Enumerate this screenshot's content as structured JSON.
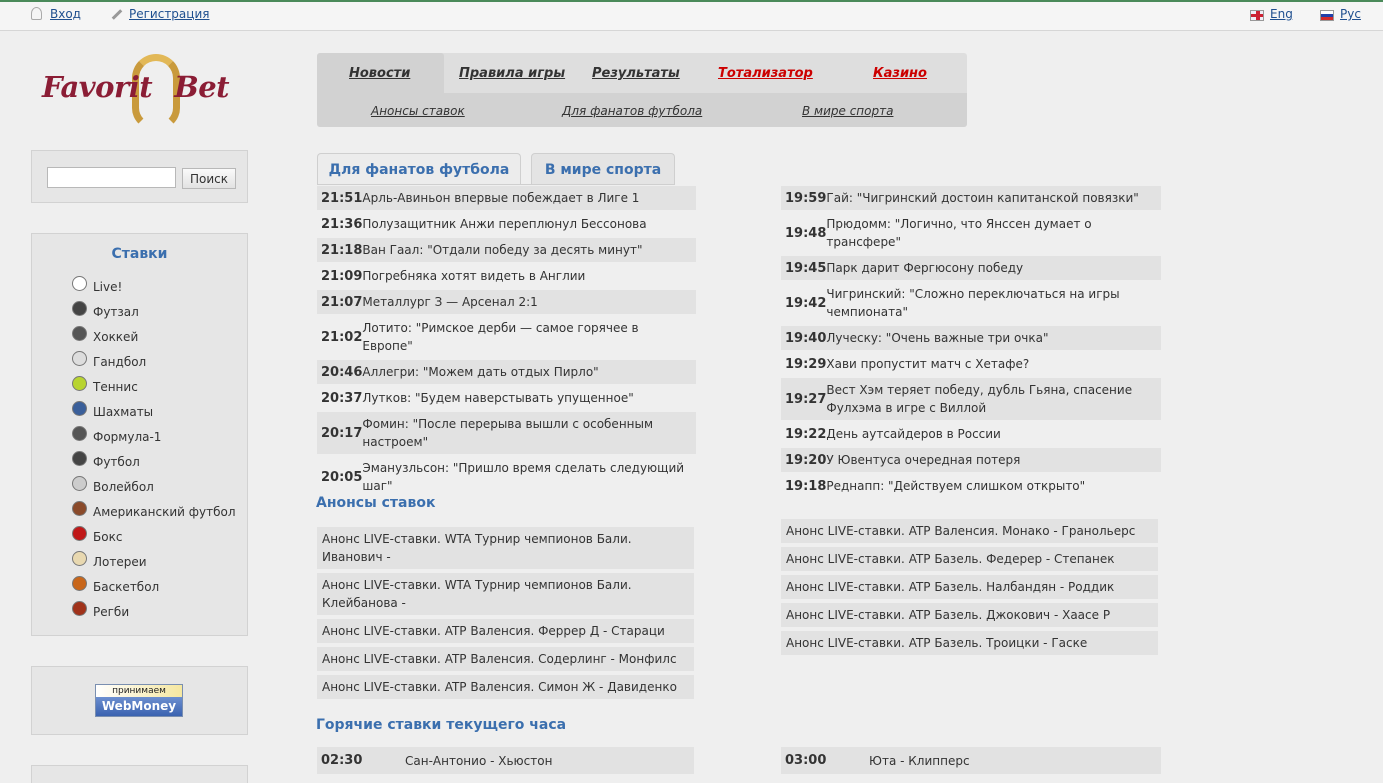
{
  "topbar": {
    "login": "Вход",
    "register": "Регистрация",
    "lang_en": "Eng",
    "lang_ru": "Рус"
  },
  "logo": {
    "text1": "Favorit",
    "text2": "Bet"
  },
  "search": {
    "button": "Поиск",
    "value": ""
  },
  "stakes": {
    "title": "Ставки",
    "items": [
      {
        "label": "Live!",
        "icon": "live-icon",
        "color": "#ffffff"
      },
      {
        "label": "Футзал",
        "icon": "soccer-ball-icon",
        "color": "#444444"
      },
      {
        "label": "Хоккей",
        "icon": "hockey-skate-icon",
        "color": "#555555"
      },
      {
        "label": "Гандбол",
        "icon": "handball-icon",
        "color": "#dddddd"
      },
      {
        "label": "Теннис",
        "icon": "tennis-ball-icon",
        "color": "#b8d430"
      },
      {
        "label": "Шахматы",
        "icon": "chess-icon",
        "color": "#3a5f9a"
      },
      {
        "label": "Формула-1",
        "icon": "arrow-right-icon",
        "color": "#555555"
      },
      {
        "label": "Футбол",
        "icon": "soccer-ball-icon",
        "color": "#444444"
      },
      {
        "label": "Волейбол",
        "icon": "volleyball-icon",
        "color": "#cccccc"
      },
      {
        "label": "Американский футбол",
        "icon": "american-football-icon",
        "color": "#8a4a2a"
      },
      {
        "label": "Бокс",
        "icon": "boxing-glove-icon",
        "color": "#c01818"
      },
      {
        "label": "Лотереи",
        "icon": "lottery-ticket-icon",
        "color": "#e8d8b0"
      },
      {
        "label": "Баскетбол",
        "icon": "basketball-icon",
        "color": "#c8661a"
      },
      {
        "label": "Регби",
        "icon": "rugby-ball-icon",
        "color": "#a0321a"
      }
    ]
  },
  "webmoney": {
    "top": "принимаем",
    "bottom": "WebMoney"
  },
  "nav": {
    "main": [
      {
        "label": "Новости",
        "active": true
      },
      {
        "label": "Правила игры",
        "active": false
      },
      {
        "label": "Результаты",
        "active": false
      },
      {
        "label": "Тотализатор",
        "active": false
      },
      {
        "label": "Казино",
        "active": false
      }
    ],
    "sub": [
      "Анонсы ставок",
      "Для фанатов футбола",
      "В мире спорта"
    ]
  },
  "content_tabs": [
    "Для фанатов футбола",
    "В мире спорта"
  ],
  "news_left": [
    {
      "time": "21:51",
      "text": "Арль-Авиньон впервые побеждает в Лиге 1"
    },
    {
      "time": "21:36",
      "text": "Полузащитник Анжи переплюнул Бессонова"
    },
    {
      "time": "21:18",
      "text": "Ван Гаал: \"Отдали победу за десять минут\""
    },
    {
      "time": "21:09",
      "text": "Погребняка хотят видеть в Англии"
    },
    {
      "time": "21:07",
      "text": "Металлург З — Арсенал 2:1"
    },
    {
      "time": "21:02",
      "text": "Лотито: \"Римское дерби — самое горячее в Европе\""
    },
    {
      "time": "20:46",
      "text": "Аллегри: \"Можем дать отдых Пирло\""
    },
    {
      "time": "20:37",
      "text": "Лутков: \"Будем наверстывать упущенное\""
    },
    {
      "time": "20:17",
      "text": "Фомин: \"После перерыва вышли с особенным настроем\""
    },
    {
      "time": "20:05",
      "text": "Эманузльсон: \"Пришло время сделать следующий шаг\""
    }
  ],
  "news_right": [
    {
      "time": "19:59",
      "text": "Гай: \"Чигринский достоин капитанской повязки\""
    },
    {
      "time": "19:48",
      "text": "Прюдомм: \"Логично, что Янссен думает о трансфере\""
    },
    {
      "time": "19:45",
      "text": "Парк дарит Фергюсону победу"
    },
    {
      "time": "19:42",
      "text": "Чигринский: \"Сложно переключаться на игры чемпионата\""
    },
    {
      "time": "19:40",
      "text": "Луческу: \"Очень важные три очка\""
    },
    {
      "time": "19:29",
      "text": "Хави пропустит матч с Хетафе?"
    },
    {
      "time": "19:27",
      "text": "Вест Хэм теряет победу, дубль Гьяна, спасение Фулхэма в игре с Виллой"
    },
    {
      "time": "19:22",
      "text": "День аутсайдеров в России"
    },
    {
      "time": "19:20",
      "text": "У Ювентуса очередная потеря"
    },
    {
      "time": "19:18",
      "text": "Реднапп: \"Действуем слишком открыто\""
    }
  ],
  "announcements_title": "Анонсы ставок",
  "announcements_left": [
    "Анонс LIVE-ставки. WTA Турнир чемпионов Бали. Иванович -",
    "Анонс LIVE-ставки. WTA Турнир чемпионов Бали. Клейбанова -",
    "Анонс LIVE-ставки. ATP Валенсия. Феррер Д - Стараци",
    "Анонс LIVE-ставки. ATP Валенсия. Содерлинг - Монфилс",
    "Анонс LIVE-ставки. ATP Валенсия. Симон Ж - Давиденко"
  ],
  "announcements_right": [
    "Анонс LIVE-ставки. ATP Валенсия. Монако - Гранольерс",
    "Анонс LIVE-ставки. ATP Базель. Федерер - Степанек",
    "Анонс LIVE-ставки. ATP Базель. Налбандян - Роддик",
    "Анонс LIVE-ставки. ATP Базель. Джокович - Хаасе Р",
    "Анонс LIVE-ставки. ATP Базель. Троицки - Гаске"
  ],
  "hot_title": "Горячие ставки текущего часа",
  "hot_left": {
    "time": "02:30",
    "match": "Сан-Антонио - Хьюстон"
  },
  "hot_right": {
    "time": "03:00",
    "match": "Юта - Клипперс"
  }
}
